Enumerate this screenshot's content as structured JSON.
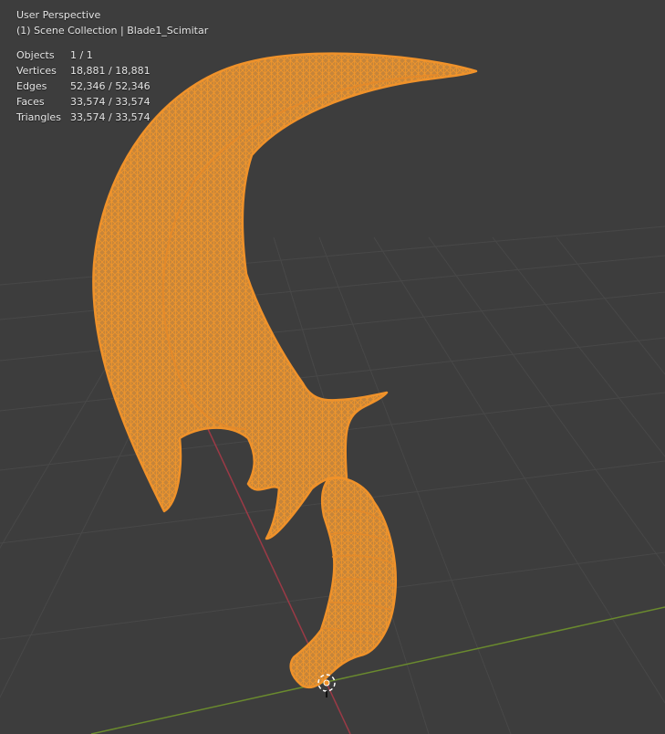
{
  "viewport": {
    "view_name": "User Perspective",
    "collection_line": "(1) Scene Collection | Blade1_Scimitar",
    "stats": [
      {
        "label": "Objects",
        "value": "1 / 1"
      },
      {
        "label": "Vertices",
        "value": "18,881 / 18,881"
      },
      {
        "label": "Edges",
        "value": "52,346 / 52,346"
      },
      {
        "label": "Faces",
        "value": "33,574 / 33,574"
      },
      {
        "label": "Triangles",
        "value": "33,574 / 33,574"
      }
    ]
  },
  "colors": {
    "background": "#3d3d3d",
    "grid": "#484848",
    "x_axis": "#9b3a46",
    "y_axis": "#6a8a2e",
    "selection": "#f0922a",
    "selection_fill": "#c8863c"
  },
  "object": {
    "name": "Blade1_Scimitar",
    "selected": true,
    "display": "wireframe"
  },
  "icons": [
    "object-origin-icon",
    "3d-cursor-icon"
  ]
}
